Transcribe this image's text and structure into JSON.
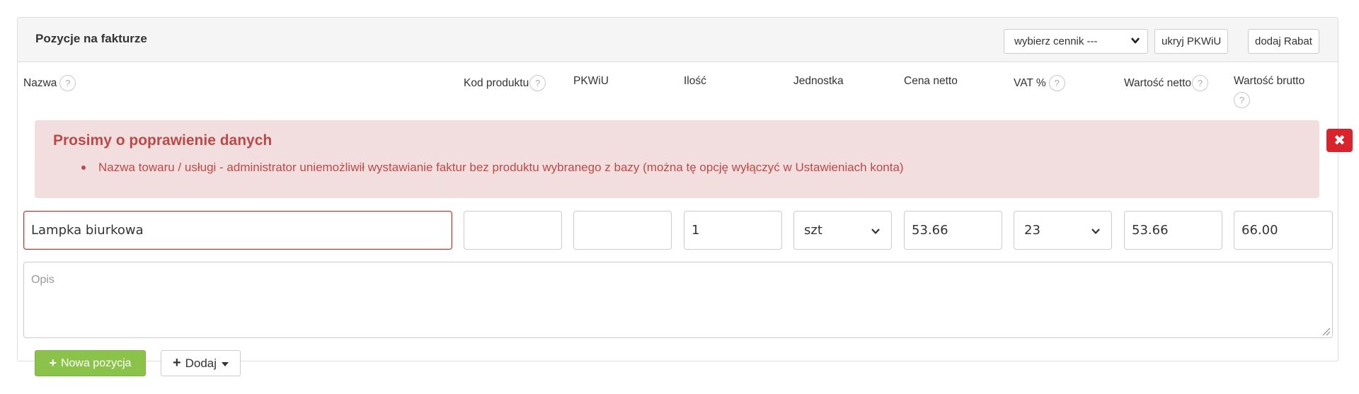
{
  "panel": {
    "title": "Pozycje na fakturze",
    "price_list_select": "wybierz cennik ---",
    "hide_pkwiu_button": "ukryj PKWiU",
    "add_discount_button": "dodaj Rabat"
  },
  "columns": {
    "name": "Nazwa",
    "product_code": "Kod produktu",
    "pkwiu": "PKWiU",
    "quantity": "Ilość",
    "unit": "Jednostka",
    "net_price": "Cena netto",
    "vat": "VAT %",
    "net_value": "Wartość netto",
    "gross_value": "Wartość brutto",
    "help_symbol": "?"
  },
  "alert": {
    "title": "Prosimy o poprawienie danych",
    "messages": [
      "Nazwa towaru / usługi - administrator uniemożliwił wystawianie faktur bez produktu wybranego z bazy (można tę opcję wyłączyć w Ustawieniach konta)"
    ],
    "close_symbol": "✖"
  },
  "row": {
    "name": "Lampka biurkowa",
    "product_code": "",
    "pkwiu": "",
    "quantity": "1",
    "unit": "szt",
    "net_price": "53.66",
    "vat": "23",
    "net_value": "53.66",
    "gross_value": "66.00",
    "description_placeholder": "Opis"
  },
  "actions": {
    "new_item": "Nowa pozycja",
    "add": "Dodaj",
    "plus_symbol": "+"
  },
  "colors": {
    "accent_green": "#8bc34a",
    "error_red": "#b94a48",
    "alert_background": "#f2dede",
    "close_button": "#d9232d"
  }
}
